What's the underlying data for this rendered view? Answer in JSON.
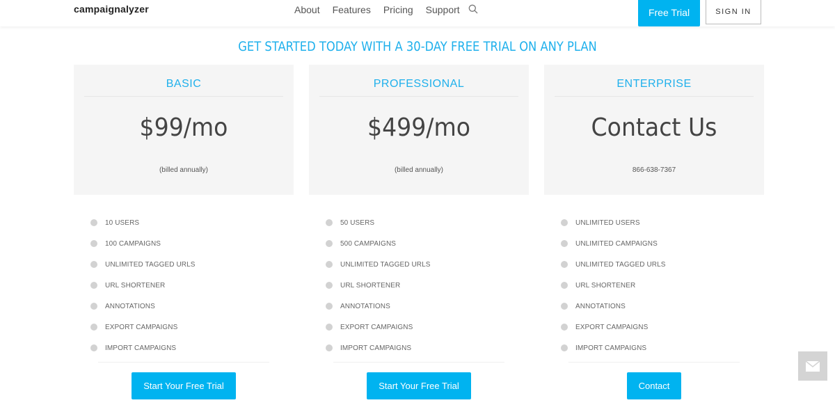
{
  "header": {
    "logo": "campaignalyzer",
    "nav": [
      "About",
      "Features",
      "Pricing",
      "Support"
    ],
    "search_icon": "search-icon",
    "free_trial": "Free Trial",
    "sign_in": "SIGN IN"
  },
  "headline": "GET STARTED TODAY WITH A 30-DAY FREE TRIAL ON ANY PLAN",
  "plans": [
    {
      "name": "BASIC",
      "price": "$99/mo",
      "sub": "(billed annually)",
      "features": [
        "10 USERS",
        "100 CAMPAIGNS",
        "UNLIMITED TAGGED URLS",
        "URL SHORTENER",
        "ANNOTATIONS",
        "EXPORT CAMPAIGNS",
        "IMPORT CAMPAIGNS"
      ],
      "cta": "Start Your Free Trial"
    },
    {
      "name": "PROFESSIONAL",
      "price": "$499/mo",
      "sub": "(billed annually)",
      "features": [
        "50 USERS",
        "500 CAMPAIGNS",
        "UNLIMITED TAGGED URLS",
        "URL SHORTENER",
        "ANNOTATIONS",
        "EXPORT CAMPAIGNS",
        "IMPORT CAMPAIGNS"
      ],
      "cta": "Start Your Free Trial"
    },
    {
      "name": "ENTERPRISE",
      "price": "Contact Us",
      "sub": "866-638-7367",
      "features": [
        "UNLIMITED USERS",
        "UNLIMITED CAMPAIGNS",
        "UNLIMITED TAGGED URLS",
        "URL SHORTENER",
        "ANNOTATIONS",
        "EXPORT CAMPAIGNS",
        "IMPORT CAMPAIGNS"
      ],
      "cta": "Contact"
    }
  ],
  "widget": {
    "icon": "mail-icon"
  },
  "colors": {
    "accent": "#00b3f0",
    "headline": "#1fb0ec",
    "card_top": "#f5f5f5"
  }
}
